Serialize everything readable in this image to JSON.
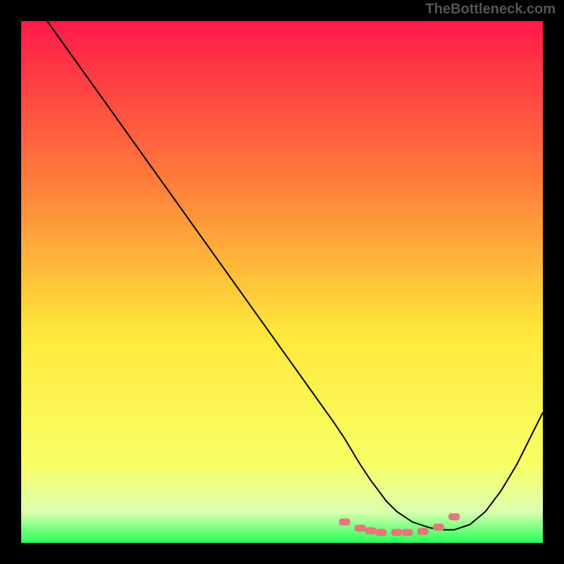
{
  "watermark": "TheBottleneck.com",
  "chart_data": {
    "type": "line",
    "title": "",
    "xlabel": "",
    "ylabel": "",
    "xlim": [
      0,
      100
    ],
    "ylim": [
      0,
      100
    ],
    "gradient_colors": {
      "top": "#ff1a4a",
      "mid1": "#ff7a3a",
      "mid2": "#ffe83a",
      "mid3": "#f7ff66",
      "bottom_band_top": "#dcffb0",
      "bottom_green": "#2aff5a"
    },
    "series": [
      {
        "name": "curve",
        "color": "#000000",
        "stroke_width": 2,
        "x": [
          5,
          10,
          15,
          20,
          25,
          30,
          35,
          40,
          45,
          50,
          55,
          60,
          62,
          65,
          67,
          70,
          72,
          75,
          78,
          80,
          83,
          86,
          89,
          92,
          95,
          98,
          100
        ],
        "y": [
          100,
          93,
          86,
          79,
          72,
          65,
          58,
          51,
          44,
          37,
          30,
          23,
          20,
          15,
          12,
          8,
          6,
          4,
          3,
          2.5,
          2.5,
          3.5,
          6,
          10,
          15,
          21,
          25
        ]
      },
      {
        "name": "markers",
        "type": "scatter_dashes",
        "color": "#e27878",
        "x": [
          62,
          65,
          67,
          69,
          72,
          74,
          77,
          80,
          83
        ],
        "y": [
          4,
          2.8,
          2.3,
          2.0,
          2.0,
          2.0,
          2.2,
          3.0,
          5.0
        ]
      }
    ]
  }
}
